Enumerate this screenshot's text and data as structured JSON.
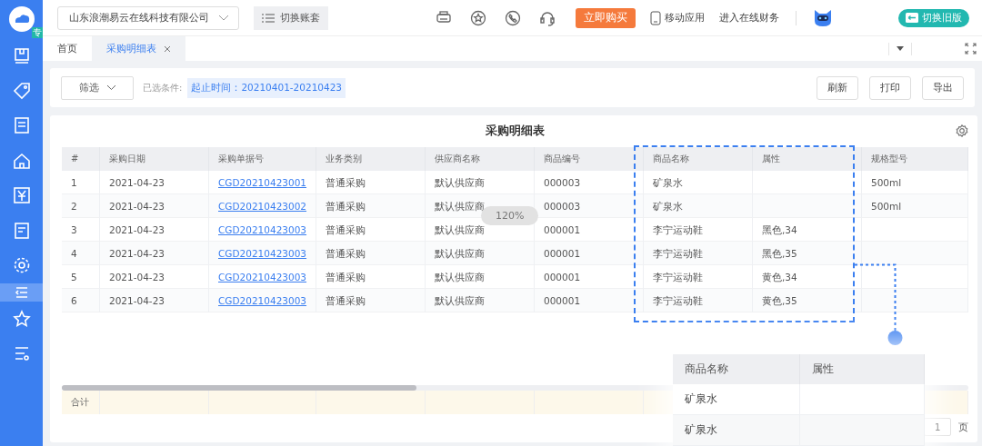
{
  "top_bar": {
    "company_select": "山东浪潮易云在线科技有限公司",
    "switch_account_button": "切换账套",
    "buy_button": "立即购买",
    "mobile_app": "移动应用",
    "online_finance": "进入在线财务",
    "switch_old_button": "切换旧版"
  },
  "sidebar": {
    "badge": "专"
  },
  "tabs": [
    {
      "label": "首页",
      "selected": false,
      "closable": false
    },
    {
      "label": "采购明细表",
      "selected": true,
      "closable": true
    }
  ],
  "filter_bar": {
    "filter_button": "筛选",
    "conditions_label": "已选条件:",
    "condition_tag": "起止时间：20210401-20210423",
    "buttons": [
      "刷新",
      "打印",
      "导出"
    ]
  },
  "report": {
    "title": "采购明细表",
    "zoom_indicator": "120%",
    "columns": [
      {
        "label": "#",
        "kind": "text"
      },
      {
        "label": "采购日期",
        "kind": "text"
      },
      {
        "label": "采购单据号",
        "kind": "link"
      },
      {
        "label": "业务类别",
        "kind": "text"
      },
      {
        "label": "供应商名称",
        "kind": "text"
      },
      {
        "label": "商品编号",
        "kind": "text"
      },
      {
        "label": "商品名称",
        "kind": "text"
      },
      {
        "label": "属性",
        "kind": "text"
      },
      {
        "label": "规格型号",
        "kind": "text"
      }
    ],
    "rows": [
      [
        "1",
        "2021-04-23",
        "CGD20210423001",
        "普通采购",
        "默认供应商",
        "000003",
        "矿泉水",
        "",
        "500ml"
      ],
      [
        "2",
        "2021-04-23",
        "CGD20210423002",
        "普通采购",
        "默认供应商",
        "000003",
        "矿泉水",
        "",
        "500ml"
      ],
      [
        "3",
        "2021-04-23",
        "CGD20210423003",
        "普通采购",
        "默认供应商",
        "000001",
        "李宁运动鞋",
        "黑色,34",
        ""
      ],
      [
        "4",
        "2021-04-23",
        "CGD20210423003",
        "普通采购",
        "默认供应商",
        "000001",
        "李宁运动鞋",
        "黑色,35",
        ""
      ],
      [
        "5",
        "2021-04-23",
        "CGD20210423003",
        "普通采购",
        "默认供应商",
        "000001",
        "李宁运动鞋",
        "黄色,34",
        ""
      ],
      [
        "6",
        "2021-04-23",
        "CGD20210423003",
        "普通采购",
        "默认供应商",
        "000001",
        "李宁运动鞋",
        "黄色,35",
        ""
      ]
    ],
    "total_label": "合计",
    "pagination": {
      "page": "1",
      "page_unit": "页"
    }
  },
  "callout": {
    "columns": [
      "商品名称",
      "属性"
    ],
    "rows": [
      [
        "矿泉水",
        ""
      ],
      [
        "矿泉水",
        ""
      ]
    ]
  }
}
